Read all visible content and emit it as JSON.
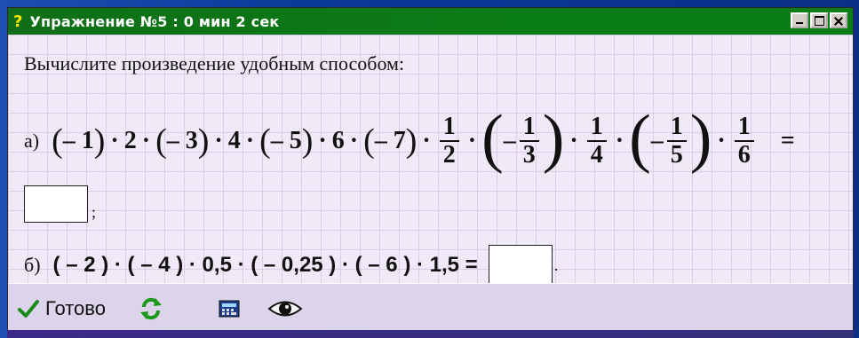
{
  "window": {
    "title_icon": "?",
    "title": "Упражнение №5 : 0 мин  2 сек",
    "buttons": [
      "minimize",
      "maximize",
      "close"
    ]
  },
  "task": {
    "instruction": "Вычислите произведение удобным способом:",
    "part_a": {
      "label": "а)",
      "factors": [
        "– 1",
        "2",
        "– 3",
        "4",
        "– 5",
        "6",
        "– 7"
      ],
      "fractions": [
        {
          "sign": "",
          "num": "1",
          "den": "2"
        },
        {
          "sign": "–",
          "num": "1",
          "den": "3"
        },
        {
          "sign": "",
          "num": "1",
          "den": "4"
        },
        {
          "sign": "–",
          "num": "1",
          "den": "5"
        },
        {
          "sign": "",
          "num": "1",
          "den": "6"
        }
      ],
      "equals": "=",
      "answer_value": "",
      "terminator": ";"
    },
    "part_b": {
      "label": "б)",
      "expression": "( – 2 ) · ( – 4 ) · 0,5 · ( – 0,25 ) · ( – 6 ) · 1,5 =",
      "answer_value": "",
      "terminator": "."
    }
  },
  "toolbar": {
    "ready_label": "Готово",
    "icons": [
      "checkmark-icon",
      "refresh-icon",
      "calculator-icon",
      "eye-icon"
    ]
  },
  "colors": {
    "titlebar": "#0b7d16",
    "background": "#0a3a9a",
    "content": "#f0e9f8"
  }
}
